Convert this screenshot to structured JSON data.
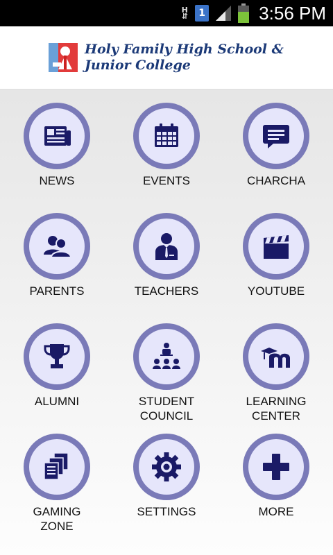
{
  "status_bar": {
    "network_type_top": "H",
    "network_type_bottom": "⇵",
    "sim_slot": "1",
    "time": "3:56 PM"
  },
  "header": {
    "school_name_line1": "Holy Family High School &",
    "school_name_line2": "Junior College",
    "logo_icon": "school-crest"
  },
  "colors": {
    "circle_ring": "#7a7ab8",
    "circle_fill": "#e6e6fb",
    "icon_color": "#1a1a66",
    "title_color": "#1c3a78"
  },
  "menu": {
    "items": [
      {
        "label": "NEWS",
        "icon": "newspaper-icon"
      },
      {
        "label": "EVENTS",
        "icon": "calendar-icon"
      },
      {
        "label": "CHARCHA",
        "icon": "chat-icon"
      },
      {
        "label": "PARENTS",
        "icon": "parents-icon"
      },
      {
        "label": "TEACHERS",
        "icon": "teacher-icon"
      },
      {
        "label": "YOUTUBE",
        "icon": "clapperboard-icon"
      },
      {
        "label": "ALUMNI",
        "icon": "trophy-icon"
      },
      {
        "label": "STUDENT\nCOUNCIL",
        "icon": "council-icon"
      },
      {
        "label": "LEARNING\nCENTER",
        "icon": "moodle-icon"
      },
      {
        "label": "GAMING\nZONE",
        "icon": "documents-icon"
      },
      {
        "label": "SETTINGS",
        "icon": "gear-icon"
      },
      {
        "label": "MORE",
        "icon": "plus-icon"
      }
    ]
  }
}
